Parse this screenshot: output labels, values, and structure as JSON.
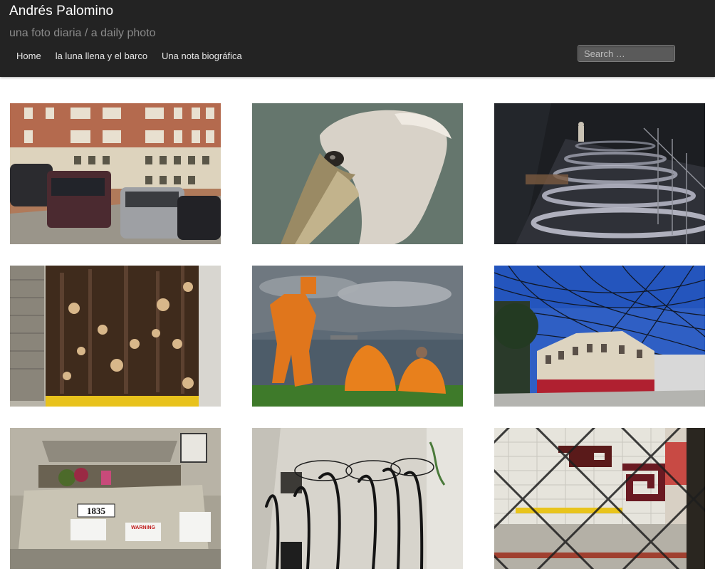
{
  "site": {
    "title": "Andrés Palomino",
    "description": "una foto diaria / a daily photo"
  },
  "nav": {
    "items": [
      {
        "label": "Home"
      },
      {
        "label": "la luna llena y el barco"
      },
      {
        "label": "Una nota biográfica"
      }
    ]
  },
  "search": {
    "placeholder": "Search …"
  },
  "gallery": {
    "house_number": "1835",
    "warning_sign": "WARNING"
  }
}
